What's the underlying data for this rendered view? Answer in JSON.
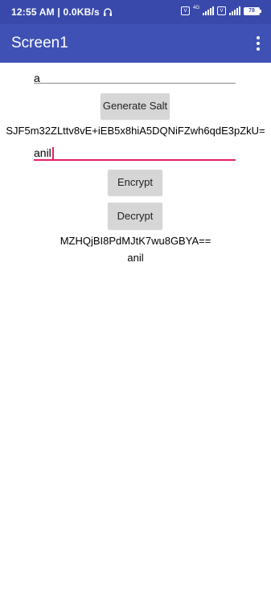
{
  "status_bar": {
    "time_speed": "12:55 AM | 0.0KB/s",
    "network_label": "4G",
    "battery": "78"
  },
  "app_bar": {
    "title": "Screen1"
  },
  "salt_input": {
    "value": "a"
  },
  "generate_salt_button": {
    "label": "Generate Salt"
  },
  "salt_output": "SJF5m32ZLttv8vE+iEB5x8hiA5DQNiFZwh6qdE3pZkU=",
  "text_input": {
    "value": "anil"
  },
  "encrypt_button": {
    "label": "Encrypt"
  },
  "decrypt_button": {
    "label": "Decrypt"
  },
  "encrypted_output": "MZHQjBI8PdMJtK7wu8GBYA==",
  "decrypted_output": "anil",
  "colors": {
    "status_bar": "#3949ab",
    "app_bar": "#3f51b5",
    "focus_accent": "#e91e63",
    "button_bg": "#d6d6d6"
  }
}
